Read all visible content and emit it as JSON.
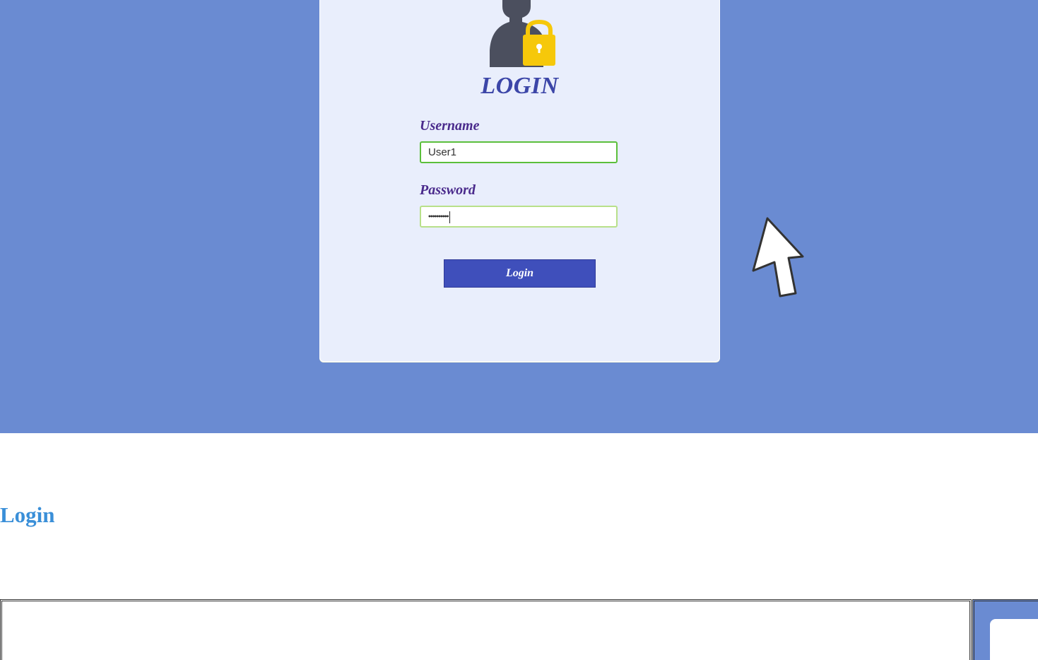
{
  "hero": {
    "card": {
      "heading": "LOGIN",
      "username": {
        "label": "Username",
        "value": "User1"
      },
      "password": {
        "label": "Password",
        "masked_value": "••••••••••"
      },
      "button_label": "Login"
    },
    "icons": {
      "user_lock": "user-lock-icon",
      "cursor": "mouse-pointer-icon"
    },
    "colors": {
      "background": "#6a8bd2",
      "card": "#e9eefc",
      "heading": "#3c46a8",
      "label": "#4a2a8c",
      "button": "#3f4fbb",
      "field_border": "#5bbf3b",
      "lock": "#f6c80a",
      "silhouette": "#4b4f5e"
    }
  },
  "page": {
    "link_text": "Login",
    "link_color": "#3a8fd8"
  }
}
